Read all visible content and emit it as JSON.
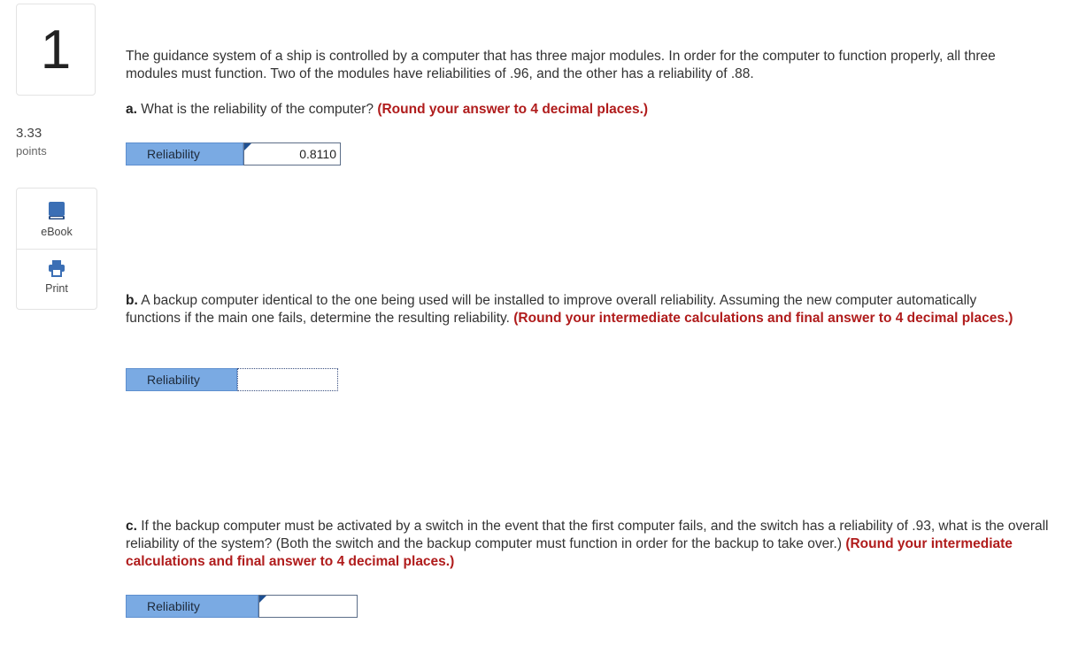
{
  "question": {
    "number": "1",
    "points_value": "3.33",
    "points_label": "points"
  },
  "tools": {
    "ebook_label": "eBook",
    "print_label": "Print"
  },
  "problem": {
    "intro": "The guidance system of a ship is controlled by a computer that has three major modules. In order for the computer to function properly, all three modules must function. Two of the modules have reliabilities of .96, and the other has a reliability of .88.",
    "part_a": {
      "label": "a.",
      "text": "What is the reliability of the computer?",
      "hint": "(Round your answer to 4 decimal places.)",
      "answer_label": "Reliability",
      "answer_value": "0.8110"
    },
    "part_b": {
      "label": "b.",
      "text": "A backup computer identical to the one being used will be installed to improve overall reliability. Assuming the new computer automatically functions if the main one fails, determine the resulting reliability.",
      "hint": "(Round your intermediate calculations and final answer to 4 decimal places.)",
      "answer_label": "Reliability",
      "answer_value": ""
    },
    "part_c": {
      "label": "c.",
      "text": "If the backup computer must be activated by a switch in the event that the first computer fails, and the switch has a reliability of .93, what is the overall reliability of the system? (Both the switch and the backup computer must function in order for the backup to take over.)",
      "hint": "(Round your intermediate calculations and final answer to 4 decimal places.)",
      "answer_label": "Reliability",
      "answer_value": ""
    }
  },
  "colors": {
    "hint": "#b01c1c",
    "answer_label_bg": "#7aaae3",
    "icon_blue": "#3b6fb5"
  }
}
